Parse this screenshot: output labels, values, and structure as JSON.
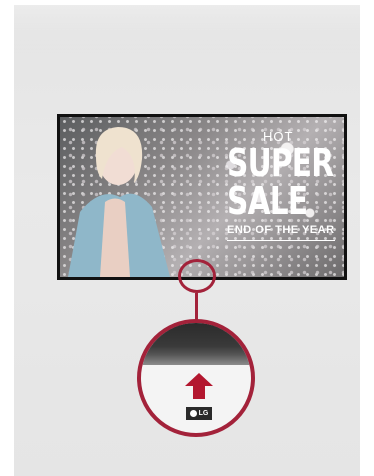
{
  "tv_screen": {
    "headline_top": "HOT",
    "headline_main_1": "SUPER",
    "headline_main_2": "SALE",
    "headline_sub": "END OF THE YEAR"
  },
  "zoom_callout": {
    "logo_text": "LG"
  },
  "colors": {
    "accent_ring": "#a3223a",
    "arrow": "#b3172f"
  }
}
